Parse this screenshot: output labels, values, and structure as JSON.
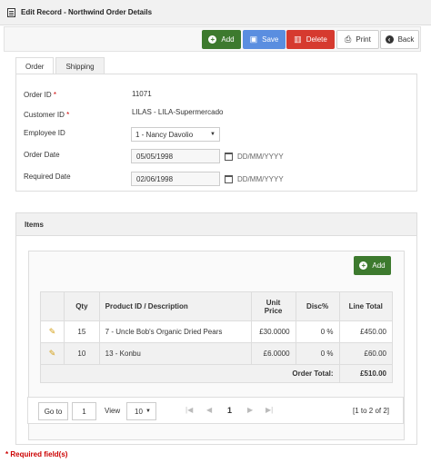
{
  "window": {
    "title": "Edit Record - Northwind Order Details"
  },
  "toolbar": {
    "add": "Add",
    "save": "Save",
    "delete": "Delete",
    "print": "Print",
    "back": "Back"
  },
  "tabs": [
    {
      "label": "Order"
    },
    {
      "label": "Shipping"
    }
  ],
  "form": {
    "order_id_label": "Order ID",
    "order_id": "11071",
    "customer_id_label": "Customer ID",
    "customer_id": "LILAS - LILA-Supermercado",
    "employee_id_label": "Employee ID",
    "employee_id": "1 - Nancy Davolio",
    "order_date_label": "Order Date",
    "order_date": "05/05/1998",
    "required_date_label": "Required Date",
    "required_date": "02/06/1998",
    "date_format": "DD/MM/YYYY",
    "required_marker": "*"
  },
  "items": {
    "title": "Items",
    "add": "Add",
    "columns": [
      "",
      "Qty",
      "Product ID / Description",
      "Unit Price",
      "Disc%",
      "Line Total"
    ],
    "rows": [
      {
        "qty": "15",
        "product": "7 - Uncle Bob's Organic Dried Pears",
        "unit_price": "£30.0000",
        "disc": "0 %",
        "line_total": "£450.00"
      },
      {
        "qty": "10",
        "product": "13 - Konbu",
        "unit_price": "£6.0000",
        "disc": "0 %",
        "line_total": "£60.00"
      }
    ],
    "total_label": "Order Total:",
    "total_value": "£510.00"
  },
  "pager": {
    "goto": "Go to",
    "goto_value": "1",
    "view": "View",
    "view_value": "10",
    "current_page": "1",
    "summary": "[1 to 2 of 2]"
  },
  "footer": {
    "required_note": "* Required field(s)"
  }
}
